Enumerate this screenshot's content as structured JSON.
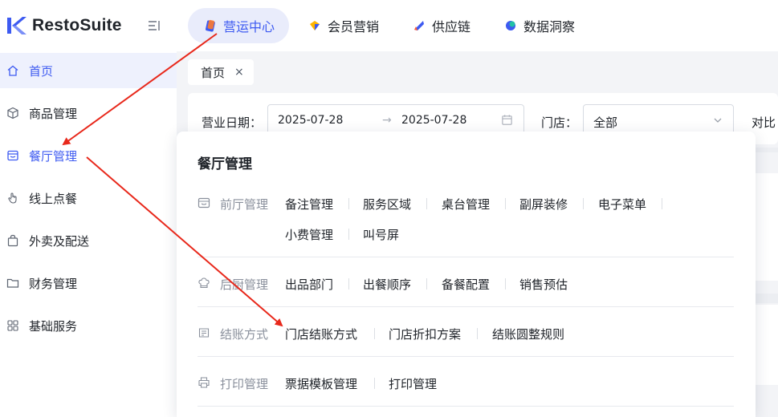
{
  "app": {
    "brand": "RestoSuite"
  },
  "modules": [
    {
      "label": "营运中心",
      "active": true
    },
    {
      "label": "会员营销"
    },
    {
      "label": "供应链"
    },
    {
      "label": "数据洞察"
    }
  ],
  "sidebar": {
    "items": [
      {
        "label": "首页",
        "active": true
      },
      {
        "label": "商品管理"
      },
      {
        "label": "餐厅管理",
        "highlighted": true
      },
      {
        "label": "线上点餐"
      },
      {
        "label": "外卖及配送"
      },
      {
        "label": "财务管理"
      },
      {
        "label": "基础服务"
      }
    ]
  },
  "tabs": [
    {
      "label": "首页",
      "close": "×"
    }
  ],
  "filters": {
    "date_label": "营业日期：",
    "date_start": "2025-07-28",
    "date_sep": "→",
    "date_end": "2025-07-28",
    "store_label": "门店：",
    "store_value": "全部",
    "compare_label": "对比"
  },
  "menu": {
    "title": "餐厅管理",
    "groups": [
      {
        "title": "前厅管理",
        "links": [
          "备注管理",
          "服务区域",
          "桌台管理",
          "副屏装修",
          "电子菜单",
          "小费管理",
          "叫号屏"
        ]
      },
      {
        "title": "后厨管理",
        "links": [
          "出品部门",
          "出餐顺序",
          "备餐配置",
          "销售预估"
        ]
      },
      {
        "title": "结账方式",
        "links": [
          "门店结账方式",
          "门店折扣方案",
          "结账圆整规则"
        ]
      },
      {
        "title": "打印管理",
        "links": [
          "票据模板管理",
          "打印管理"
        ]
      }
    ]
  },
  "colors": {
    "accent": "#3d5af1",
    "annotation": "#e8281b"
  }
}
